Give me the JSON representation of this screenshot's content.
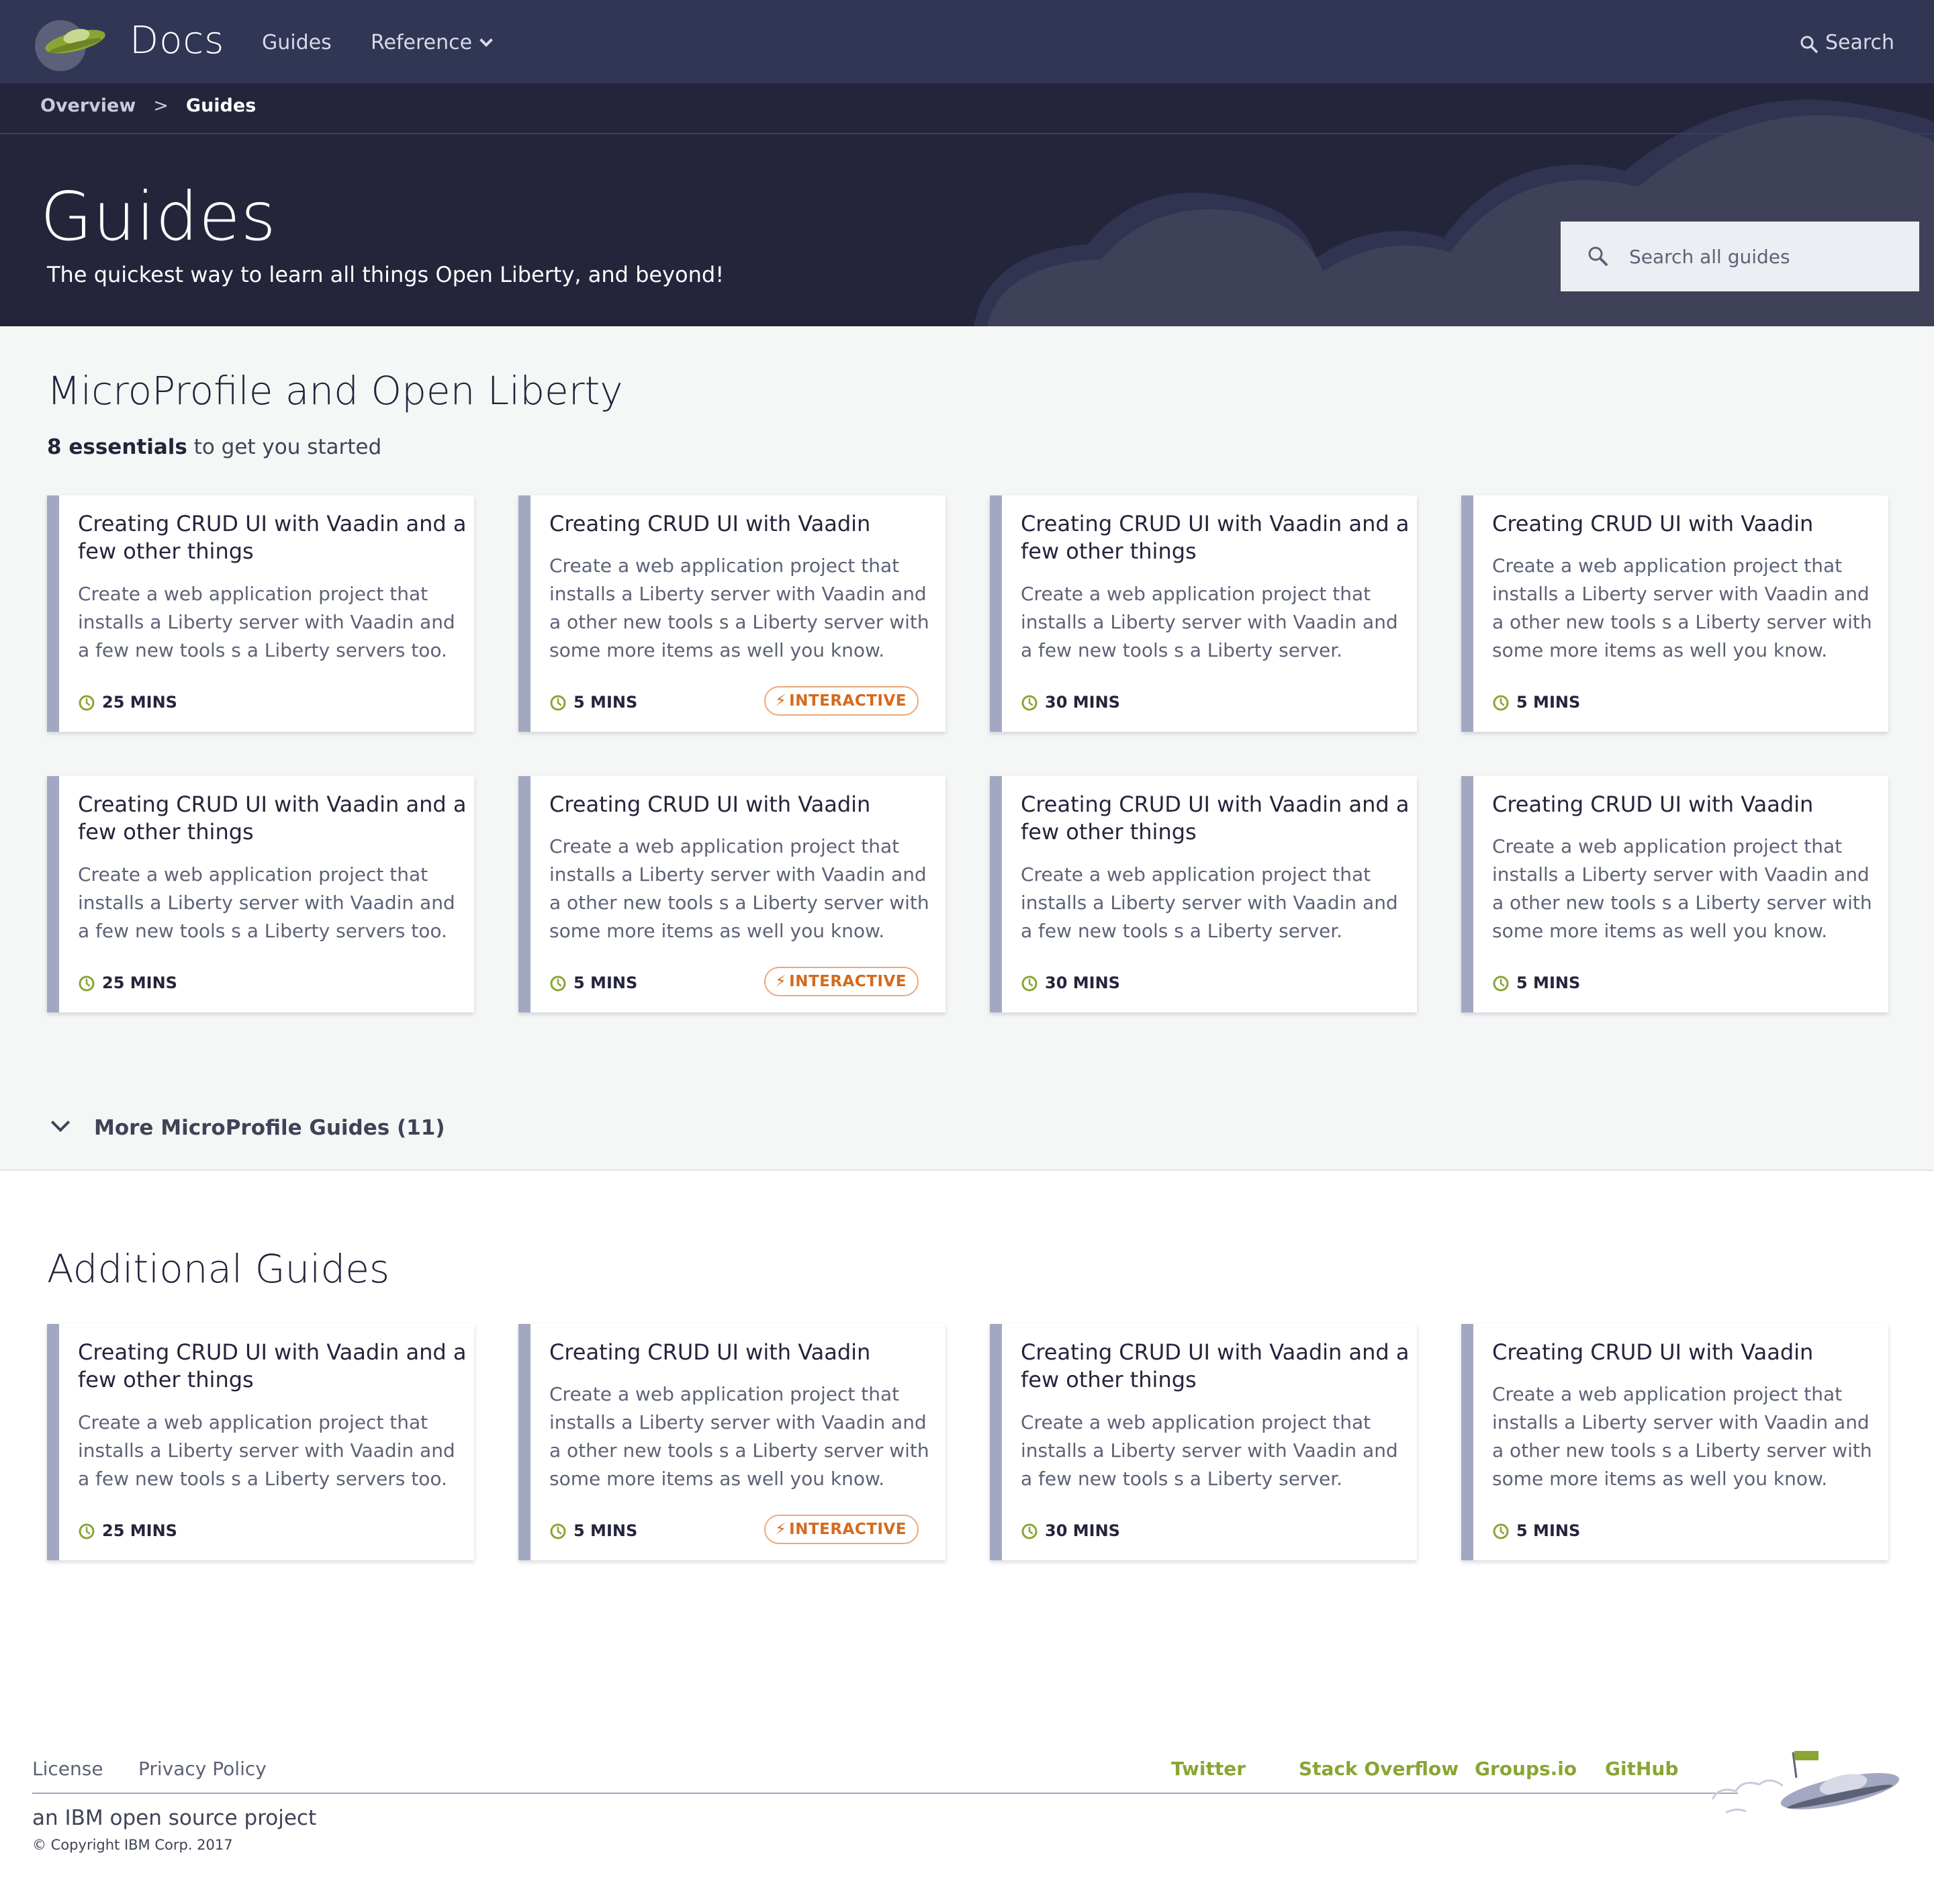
{
  "nav": {
    "brand": "Docs",
    "links": [
      {
        "label": "Guides"
      },
      {
        "label": "Reference"
      }
    ],
    "search_label": "Search"
  },
  "breadcrumb": {
    "items": [
      "Overview",
      "Guides"
    ],
    "separator": ">"
  },
  "hero": {
    "title": "Guides",
    "subtitle": "The quickest way to learn all things Open Liberty, and beyond!",
    "search_placeholder": "Search all guides"
  },
  "microprofile": {
    "title": "MicroProfile and Open Liberty",
    "count_bold": "8 essentials",
    "count_rest": " to get you started",
    "more_label": "More MicroProfile Guides (11)",
    "cards": [
      {
        "title": "Creating CRUD UI with Vaadin and a few other things",
        "desc": "Create a web application project that installs a Liberty server with Vaadin and a few new tools s a Liberty servers too.",
        "time": "25 MINS",
        "badge": ""
      },
      {
        "title": "Creating CRUD UI with Vaadin",
        "desc": "Create a web application project that installs a Liberty server with Vaadin and a other new tools s a Liberty server with some more items as well you know.",
        "time": "5 MINS",
        "badge": "INTERACTIVE"
      },
      {
        "title": "Creating CRUD UI with Vaadin and a few other things",
        "desc": "Create a web application project that installs a Liberty server with Vaadin and a few new tools s a Liberty server.",
        "time": "30 MINS",
        "badge": ""
      },
      {
        "title": "Creating CRUD UI with Vaadin",
        "desc": "Create a web application project that installs a Liberty server with Vaadin and a other new tools s a Liberty server with some more items as well you know.",
        "time": "5 MINS",
        "badge": ""
      },
      {
        "title": "Creating CRUD UI with Vaadin and a few other things",
        "desc": "Create a web application project that installs a Liberty server with Vaadin and a few new tools s a Liberty servers too.",
        "time": "25 MINS",
        "badge": ""
      },
      {
        "title": "Creating CRUD UI with Vaadin",
        "desc": "Create a web application project that installs a Liberty server with Vaadin and a other new tools s a Liberty server with some more items as well you know.",
        "time": "5 MINS",
        "badge": "INTERACTIVE"
      },
      {
        "title": "Creating CRUD UI with Vaadin and a few other things",
        "desc": "Create a web application project that installs a Liberty server with Vaadin and a few new tools s a Liberty server.",
        "time": "30 MINS",
        "badge": ""
      },
      {
        "title": "Creating CRUD UI with Vaadin",
        "desc": "Create a web application project that installs a Liberty server with Vaadin and a other new tools s a Liberty server with some more items as well you know.",
        "time": "5 MINS",
        "badge": ""
      }
    ]
  },
  "additional": {
    "title": "Additional Guides",
    "cards": [
      {
        "title": "Creating CRUD UI with Vaadin and a few other things",
        "desc": "Create a web application project that installs a Liberty server with Vaadin and a few new tools s a Liberty servers too.",
        "time": "25 MINS",
        "badge": ""
      },
      {
        "title": "Creating CRUD UI with Vaadin",
        "desc": "Create a web application project that installs a Liberty server with Vaadin and a other new tools s a Liberty server with some more items as well you know.",
        "time": "5 MINS",
        "badge": "INTERACTIVE"
      },
      {
        "title": "Creating CRUD UI with Vaadin and a few other things",
        "desc": "Create a web application project that installs a Liberty server with Vaadin and a few new tools s a Liberty server.",
        "time": "30 MINS",
        "badge": ""
      },
      {
        "title": "Creating CRUD UI with Vaadin",
        "desc": "Create a web application project that installs a Liberty server with Vaadin and a other new tools s a Liberty server with some more items as well you know.",
        "time": "5 MINS",
        "badge": ""
      }
    ]
  },
  "footer": {
    "left_links": [
      "License",
      "Privacy Policy"
    ],
    "right_links": [
      "Twitter",
      "Stack Overflow",
      "Groups.io",
      "GitHub"
    ],
    "tagline": "an IBM open source project",
    "copyright": "© Copyright IBM Corp. 2017"
  },
  "colors": {
    "nav_bg": "#313655",
    "hero_bg": "#24243b",
    "card_accent": "#a3a8c2",
    "clock_green": "#8aa533",
    "badge_orange": "#d46a1f",
    "footer_link_green": "#8aa533"
  }
}
